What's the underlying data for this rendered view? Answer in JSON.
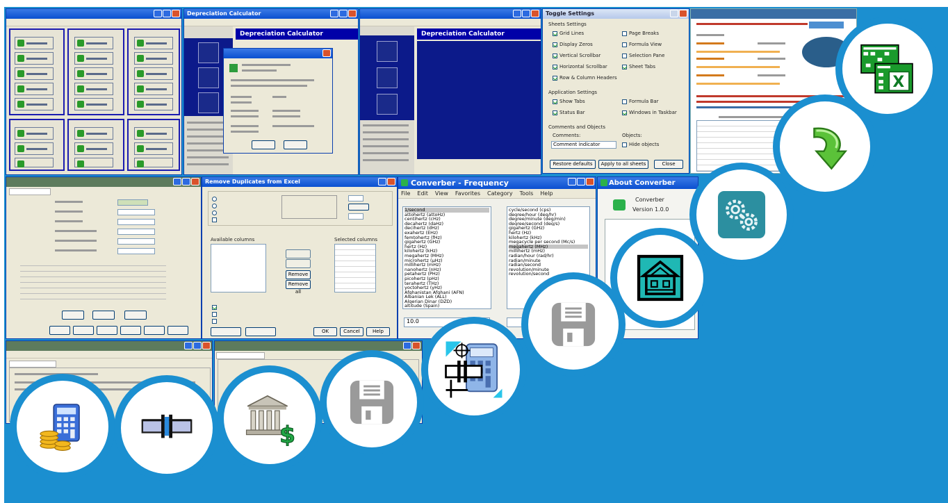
{
  "depreciation_window": {
    "title": "Depreciation Calculator",
    "heading": "Depreciation Calculator"
  },
  "toggle_window": {
    "title": "Toggle Settings",
    "sheets_heading": "Sheets Settings",
    "sheet_options": [
      "Grid Lines",
      "Display Zeros",
      "Vertical Scrollbar",
      "Horizontal Scrollbar",
      "Row & Column Headers"
    ],
    "sheet_options_right": [
      "Page Breaks",
      "Formula View",
      "Selection Pane",
      "Sheet Tabs"
    ],
    "app_heading": "Application Settings",
    "app_options": [
      "Show Tabs",
      "Status Bar"
    ],
    "app_options_right": [
      "Formula Bar",
      "Windows in Taskbar"
    ],
    "comments_heading": "Comments and Objects",
    "comments_label": "Comments:",
    "objects_label": "Objects:",
    "comments_value": "Comment indicator",
    "hide_objects": "Hide objects",
    "buttons": [
      "Restore defaults",
      "Apply to all sheets",
      "Close"
    ]
  },
  "converter_window": {
    "title": "Converber - Frequency",
    "menu": [
      "File",
      "Edit",
      "View",
      "Favorites",
      "Category",
      "Tools",
      "Help"
    ],
    "left_units": [
      "1/second",
      "attohertz (attoHz)",
      "centihertz (cHz)",
      "decahertz (daHz)",
      "decihertz (dHz)",
      "exahertz (EHz)",
      "femtohertz (fHz)",
      "gigahertz (GHz)",
      "hertz (Hz)",
      "kilohertz (kHz)",
      "megahertz (MHz)",
      "microhertz (µHz)",
      "millihertz (mHz)",
      "nanohertz (nHz)",
      "petahertz (PHz)",
      "picohertz (pHz)",
      "terahertz (THz)",
      "yoctohertz (yHz)",
      "Afghanistan Afghani (AFN)",
      "Albanian Lek (ALL)",
      "Algerian Dinar (DZD)",
      "altitude (Spain)"
    ],
    "right_units": [
      "cycle/second (cps)",
      "degree/hour (deg/hr)",
      "degree/minute (deg/min)",
      "degree/second (deg/s)",
      "gigahertz (GHz)",
      "hertz (Hz)",
      "kilohertz (kHz)",
      "megacycle per second (Mc/s)",
      "megahertz (MHz)",
      "millihertz (mHz)",
      "radian/hour (rad/hr)",
      "radian/minute",
      "radian/second",
      "revolution/minute",
      "revolution/second"
    ],
    "input_value": "10.0"
  },
  "about_window": {
    "title": "About Converber",
    "app_name": "Converber",
    "version": "Version 1.0.0"
  },
  "remove_dup_window": {
    "title": "Remove Duplicates from Excel",
    "available_columns_label": "Available columns",
    "selected_columns_label": "Selected columns",
    "buttons": [
      "Remove",
      "Remove all",
      "OK",
      "Cancel",
      "Help"
    ]
  },
  "colors": {
    "accent": "#1b8fd0",
    "titlebar": "#0a4fd0"
  },
  "icons": [
    "coins-calculator-icon",
    "pipe-fitting-icon",
    "bank-dollar-icon",
    "floppy-save-icon",
    "calculator-pipe-icon",
    "floppy-save-icon",
    "house-blueprint-icon",
    "gears-icon",
    "green-down-arrow-icon",
    "excel-spreadsheet-icon"
  ]
}
